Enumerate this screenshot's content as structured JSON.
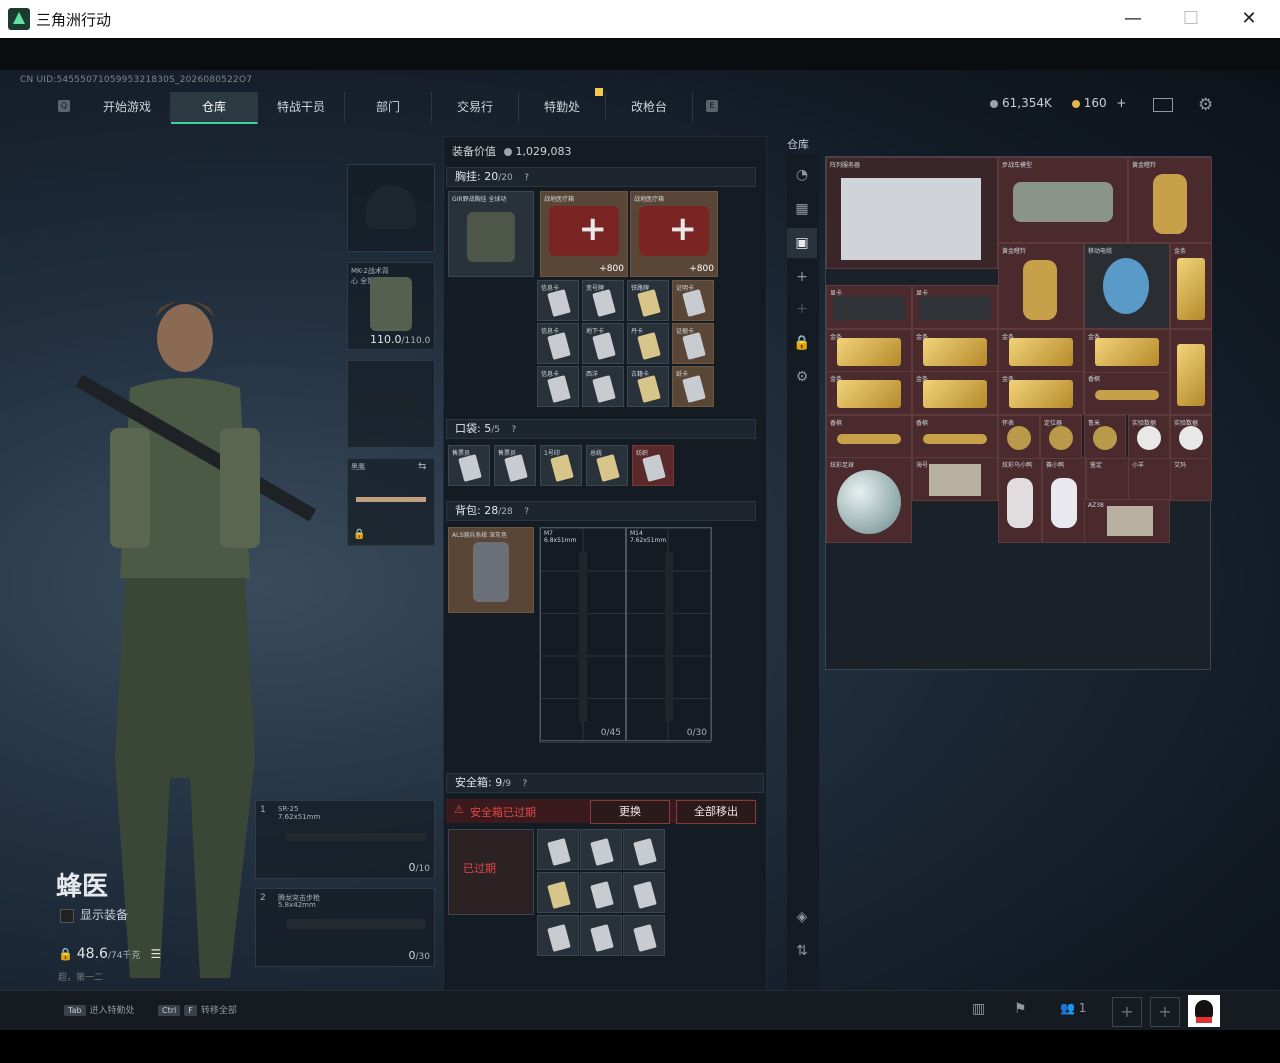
{
  "window": {
    "title": "三角洲行动",
    "minimize": "—",
    "maximize": "☐",
    "close": "✕"
  },
  "uid": "CN UID:5455507105995321830S_2026080522O7",
  "nav": {
    "key_left": "Q",
    "key_right": "E",
    "tabs": [
      "开始游戏",
      "仓库",
      "特战干员",
      "部门",
      "交易行",
      "特勤处",
      "改枪台"
    ],
    "active_index": 1
  },
  "currency": {
    "coins": "61,354K",
    "tokens": "160",
    "plus": "+"
  },
  "character": {
    "name": "蜂医",
    "show_equipment": "显示装备",
    "weight_value": "48.6",
    "weight_max": "/74千克",
    "weight_note": "超，第一二",
    "armor_label": "MK-2战术背心 全钢力",
    "armor_value": "110.0",
    "armor_max": "/110.0",
    "melee_label": "黑鹰",
    "weapon1_label": "SR-25",
    "weapon1_cal": "7.62x51mm",
    "weapon1_ammo": "0",
    "weapon1_ammo_max": "/10",
    "weapon2_label": "腾龙突击步枪",
    "weapon2_cal": "5.8x42mm",
    "weapon2_ammo": "0",
    "weapon2_ammo_max": "/30"
  },
  "loadout": {
    "value_label": "装备价值",
    "value": "1,029,083",
    "chest_label": "胸挂:",
    "chest_count": "20",
    "chest_max": "/20",
    "chest_rig_name": "GIR野战胸挂 全球功",
    "med1": "战地医疗箱",
    "med1_qty": "+800",
    "med2": "战地医疗箱",
    "med2_qty": "+800",
    "cards": [
      "信息卡",
      "变号牌",
      "铁路牌",
      "证明卡",
      "信息卡",
      "地下卡",
      "丹卡",
      "证据卡",
      "信息卡",
      "西洋",
      "古籍卡",
      "纸卡"
    ],
    "pocket_label": "口袋:",
    "pocket_count": "5",
    "pocket_max": "/5",
    "pocket_items": [
      "售票员",
      "售票员",
      "1号印",
      "总统",
      "纺织"
    ],
    "backpack_label": "背包:",
    "backpack_count": "28",
    "backpack_max": "/28",
    "backpack_name": "ALS骑兵系统 深灰色",
    "gun1_name": "M7",
    "gun1_cal": "6.8x51mm",
    "gun1_ammo": "0/45",
    "gun2_name": "M14",
    "gun2_cal": "7.62x51mm",
    "gun2_ammo": "0/30",
    "safebox_label": "安全箱:",
    "safebox_count": "9",
    "safebox_max": "/9",
    "safebox_warning": "安全箱已过期",
    "safebox_expired": "已过期",
    "btn_replace": "更换",
    "btn_move_all": "全部移出"
  },
  "stash": {
    "title": "仓库",
    "items": [
      "阵列服务器",
      "步战车模型",
      "黄金瞪羚",
      "黄金瞪羚",
      "移动电缆",
      "金条",
      "显卡",
      "显卡",
      "金条",
      "金条",
      "金条",
      "金条",
      "金条",
      "金条",
      "金条",
      "金条",
      "香槟",
      "香槟",
      "香槟",
      "怀表",
      "定位器",
      "鲁米",
      "实验数据",
      "实验数据",
      "炫彩足球",
      "海号",
      "炫彩乌小鸭",
      "赛小鸭",
      "鉴定",
      "小羊",
      "艾玛",
      "AZ38"
    ]
  },
  "footer": {
    "hint1_key": "Tab",
    "hint1": "进入特勤处",
    "hint2_key1": "Ctrl",
    "hint2_key2": "F",
    "hint2": "转移全部",
    "friends": "1"
  }
}
